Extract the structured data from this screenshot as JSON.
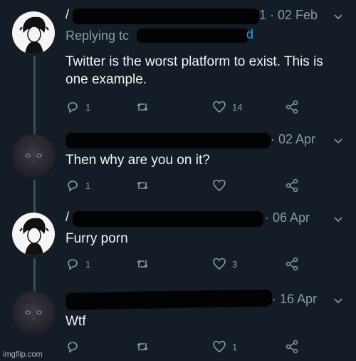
{
  "tweets": [
    {
      "author_visible": "/",
      "date": "1 · 02 Feb",
      "replying": "Replying tc",
      "replying_tail": "d",
      "text": "Twitter is the worst platform to exist. This is one example.",
      "replies": "1",
      "retweets": "",
      "likes": "14",
      "avatar": "boy-avatar-icon"
    },
    {
      "author_visible": "",
      "date": "· 02 Apr",
      "text": "Then why are you on it?",
      "replies": "1",
      "retweets": "",
      "likes": "",
      "avatar": "cat-avatar-icon"
    },
    {
      "author_visible": "/",
      "date": "· 06 Apr",
      "text": "Furry porn",
      "replies": "1",
      "retweets": "",
      "likes": "3",
      "avatar": "boy-avatar-icon"
    },
    {
      "author_visible": "",
      "date": "· 16 Apr",
      "text": "Wtf",
      "replies": "",
      "retweets": "",
      "likes": "1",
      "avatar": "cat-avatar-icon"
    }
  ],
  "watermark": "imgflip.com",
  "colors": {
    "background": "#141d26",
    "muted": "#8899a6",
    "text": "#f2f5f7",
    "thread": "#3c4d60"
  }
}
